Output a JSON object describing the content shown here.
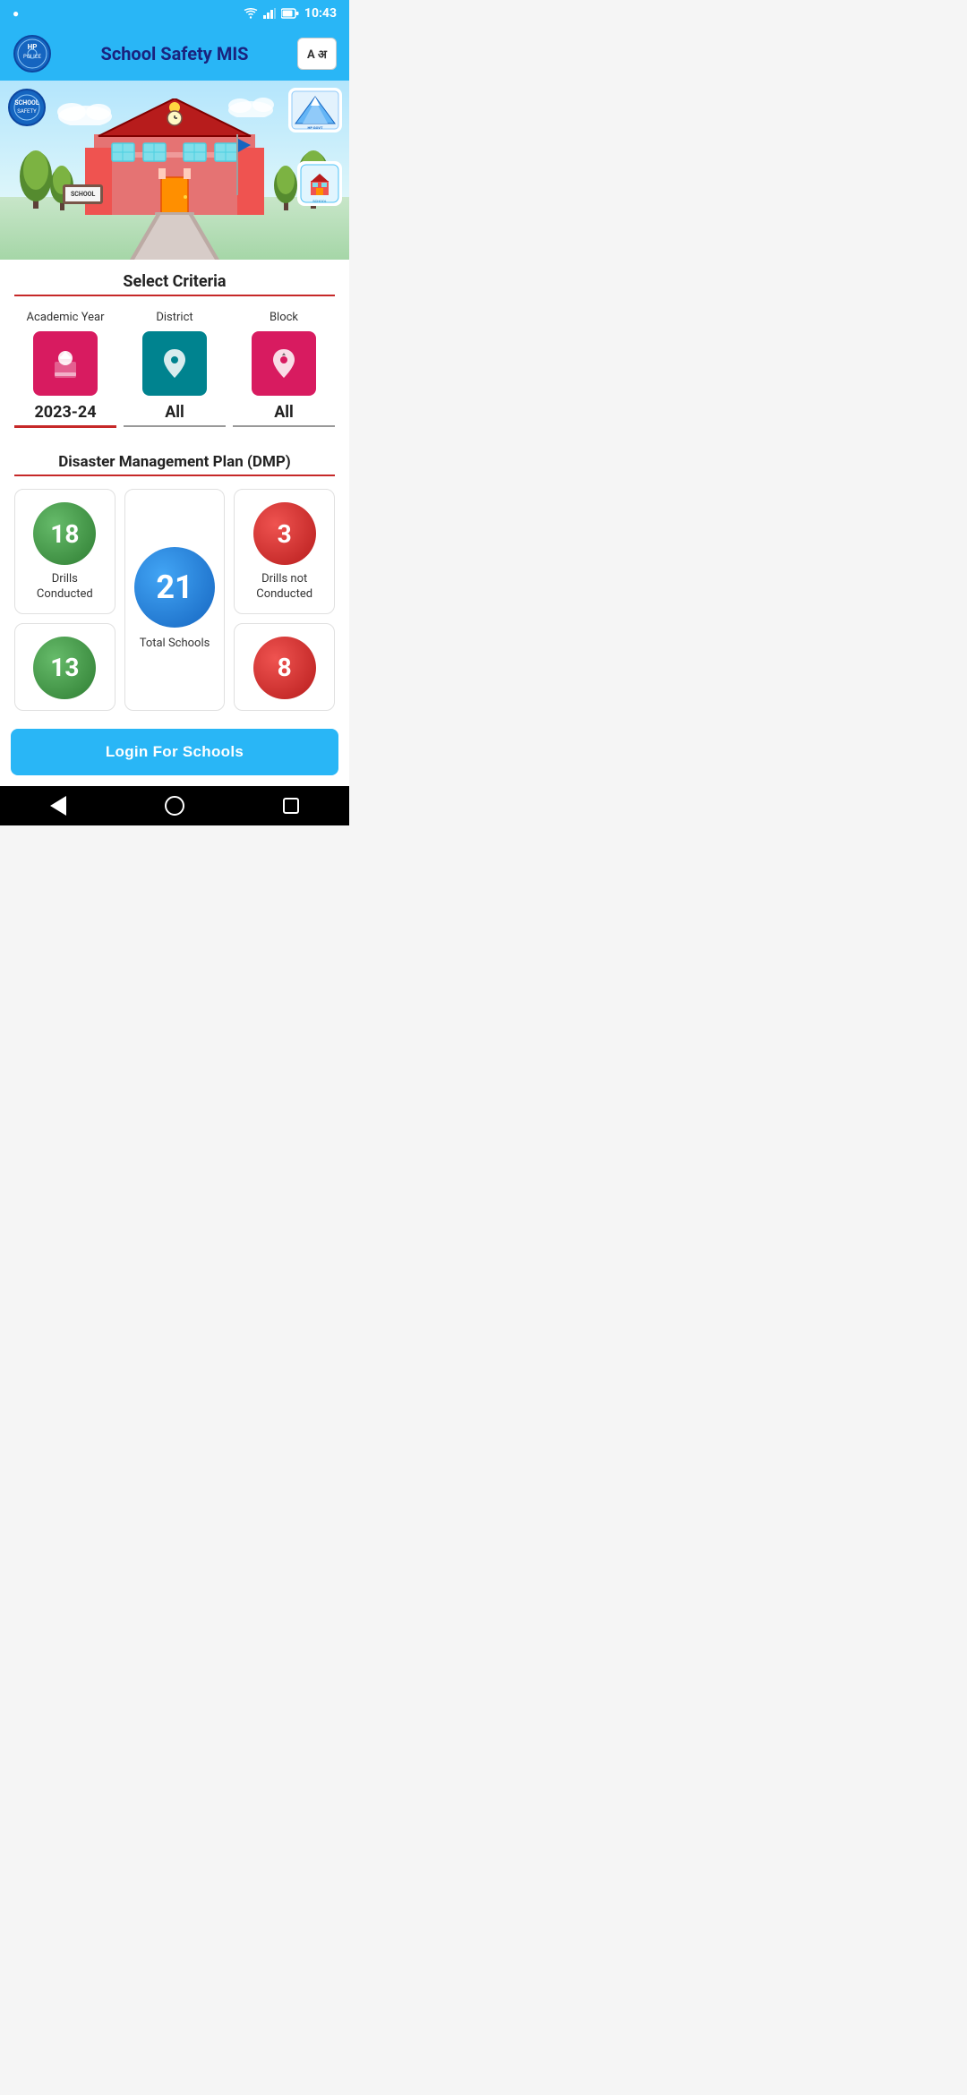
{
  "statusBar": {
    "indicator": "●",
    "time": "10:43",
    "icons": "wifi signal battery"
  },
  "appBar": {
    "title": "School Safety MIS",
    "langButton": "A अ"
  },
  "criteria": {
    "sectionTitle": "Select Criteria",
    "items": [
      {
        "id": "academic-year",
        "label": "Academic Year",
        "value": "2023-24",
        "iconType": "graduation",
        "colorClass": "pink"
      },
      {
        "id": "district",
        "label": "District",
        "value": "All",
        "iconType": "map",
        "colorClass": "teal"
      },
      {
        "id": "block",
        "label": "Block",
        "value": "All",
        "iconType": "location",
        "colorClass": "pink"
      }
    ]
  },
  "dmp": {
    "sectionTitle": "Disaster Management Plan (DMP)",
    "stats": [
      {
        "id": "drills-conducted",
        "value": "18",
        "label": "Drills Conducted",
        "colorClass": "green"
      },
      {
        "id": "total-schools",
        "value": "21",
        "label": "Total Schools",
        "colorClass": "blue",
        "featured": true
      },
      {
        "id": "drills-not-conducted",
        "value": "3",
        "label": "Drills not Conducted",
        "colorClass": "red"
      },
      {
        "id": "stat-bottom-left",
        "value": "13",
        "label": "",
        "colorClass": "green"
      },
      {
        "id": "stat-bottom-right",
        "value": "8",
        "label": "",
        "colorClass": "red"
      }
    ]
  },
  "loginButton": {
    "label": "Login For Schools"
  },
  "hero": {
    "signText": "SCHOOL"
  }
}
